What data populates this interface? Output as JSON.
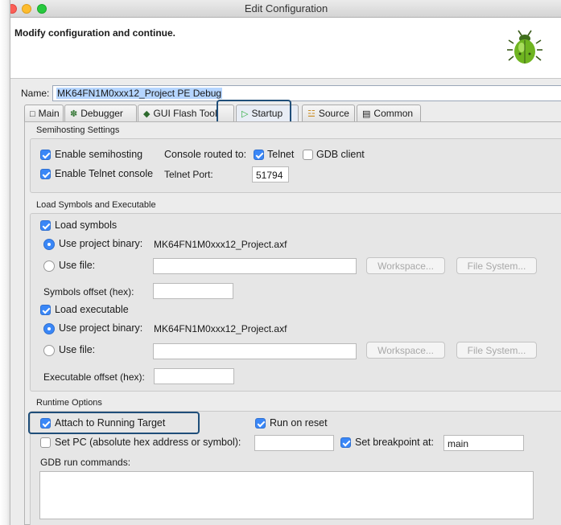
{
  "window": {
    "title": "Edit Configuration"
  },
  "banner": {
    "message": "Modify configuration and continue."
  },
  "name": {
    "label": "Name:",
    "value": "MK64FN1M0xxx12_Project PE Debug"
  },
  "tabs": [
    {
      "label": "Main",
      "icon": "document-icon"
    },
    {
      "label": "Debugger",
      "icon": "debugger-icon"
    },
    {
      "label": "GUI Flash Tool",
      "icon": "flash-icon"
    },
    {
      "label": "Startup",
      "icon": "play-icon",
      "active": true
    },
    {
      "label": "Source",
      "icon": "source-icon"
    },
    {
      "label": "Common",
      "icon": "common-icon"
    }
  ],
  "semihosting": {
    "title": "Semihosting Settings",
    "enable_semihosting": "Enable semihosting",
    "console_routed": "Console routed to:",
    "telnet": "Telnet",
    "gdb_client": "GDB client",
    "enable_telnet_console": "Enable Telnet console",
    "telnet_port_label": "Telnet Port:",
    "telnet_port_value": "51794"
  },
  "load": {
    "title": "Load Symbols and Executable",
    "load_symbols": "Load symbols",
    "use_project_binary": "Use project binary:",
    "symbols_binary": "MK64FN1M0xxx12_Project.axf",
    "use_file": "Use file:",
    "workspace": "Workspace...",
    "file_system": "File System...",
    "symbols_offset": "Symbols offset (hex):",
    "load_executable": "Load executable",
    "exec_binary": "MK64FN1M0xxx12_Project.axf",
    "executable_offset": "Executable offset (hex):"
  },
  "runtime": {
    "title": "Runtime Options",
    "attach": "Attach to Running Target",
    "run_on_reset": "Run on reset",
    "set_pc": "Set PC (absolute hex address or symbol):",
    "set_breakpoint": "Set breakpoint at:",
    "breakpoint_value": "main",
    "gdb_run_commands": "GDB run commands:"
  },
  "colors": {
    "highlight": "#1f4e79",
    "check": "#3a87f7"
  }
}
